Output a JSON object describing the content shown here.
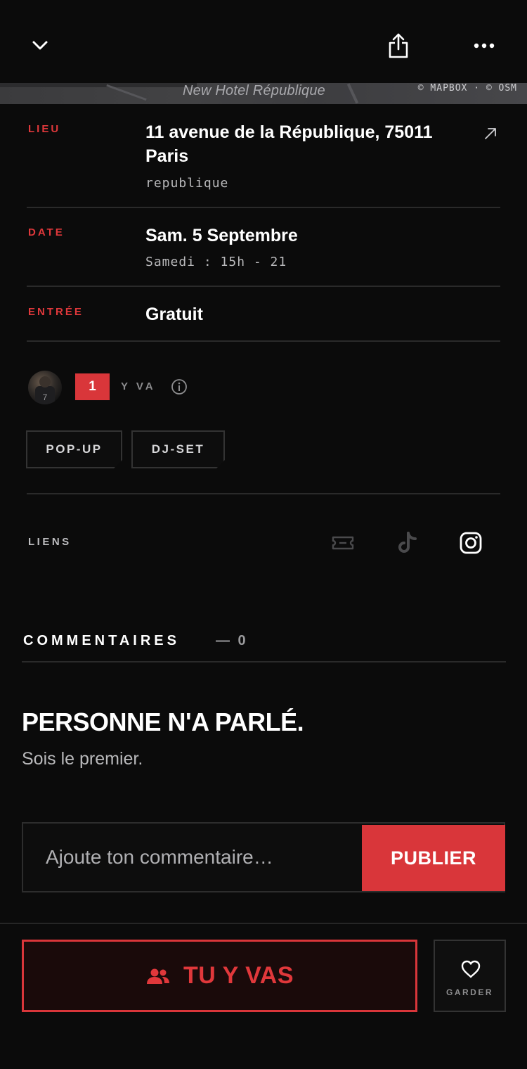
{
  "header": {
    "collapse_icon": "chevron-down-icon",
    "share_icon": "share-icon",
    "more_icon": "more-icon"
  },
  "map": {
    "place_label": "New Hotel République",
    "attribution": "© MAPBOX · © OSM"
  },
  "details": {
    "location": {
      "label": "LIEU",
      "address": "11 avenue de la République, 75011 Paris",
      "area": "republique",
      "external_icon": "arrow-up-right-icon"
    },
    "date": {
      "label": "DATE",
      "value": "Sam. 5 Septembre",
      "detail": "Samedi : 15h - 21"
    },
    "entry": {
      "label": "ENTRÉE",
      "value": "Gratuit"
    }
  },
  "attendance": {
    "count": "1",
    "label": "Y VA",
    "info_icon": "info-icon"
  },
  "tags": [
    "POP-UP",
    "DJ-SET"
  ],
  "links": {
    "label": "LIENS",
    "icons": [
      "ticket-icon",
      "tiktok-icon",
      "instagram-icon"
    ]
  },
  "comments": {
    "title": "COMMENTAIRES",
    "count": "— 0",
    "empty_title": "PERSONNE N'A PARLÉ.",
    "empty_subtitle": "Sois le premier.",
    "input_placeholder": "Ajoute ton commentaire…",
    "publish_label": "PUBLIER"
  },
  "actions": {
    "going_label": "TU Y VAS",
    "going_icon": "people-icon",
    "save_label": "GARDER",
    "save_icon": "heart-icon"
  },
  "colors": {
    "accent": "#d9363a",
    "background": "#0b0b0b"
  }
}
